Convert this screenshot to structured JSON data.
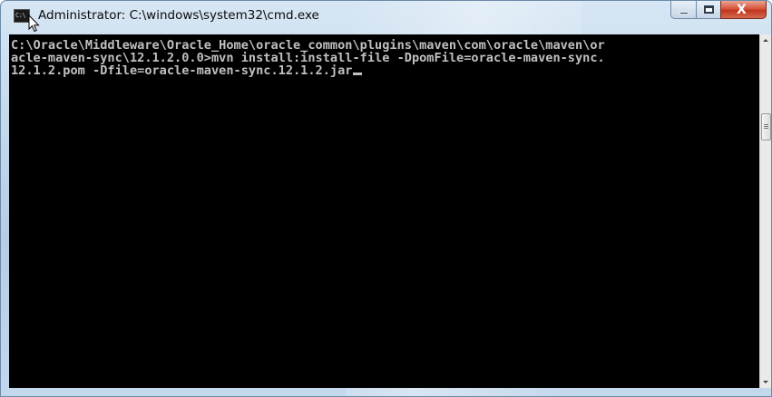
{
  "window": {
    "title": "Administrator: C:\\windows\\system32\\cmd.exe",
    "icon": "cmd-icon",
    "icon_text": "C:\\"
  },
  "caption_buttons": {
    "minimize": "minimize-icon",
    "maximize": "maximize-icon",
    "close": "close-icon",
    "close_glyph": "X"
  },
  "console": {
    "lines": [
      "C:\\Oracle\\Middleware\\Oracle_Home\\oracle_common\\plugins\\maven\\com\\oracle\\maven\\or",
      "acle-maven-sync\\12.1.2.0.0>mvn install:install-file -DpomFile=oracle-maven-sync.",
      "12.1.2.pom -Dfile=oracle-maven-sync.12.1.2.jar"
    ],
    "background": "#000000",
    "foreground": "#c0c0c0"
  }
}
